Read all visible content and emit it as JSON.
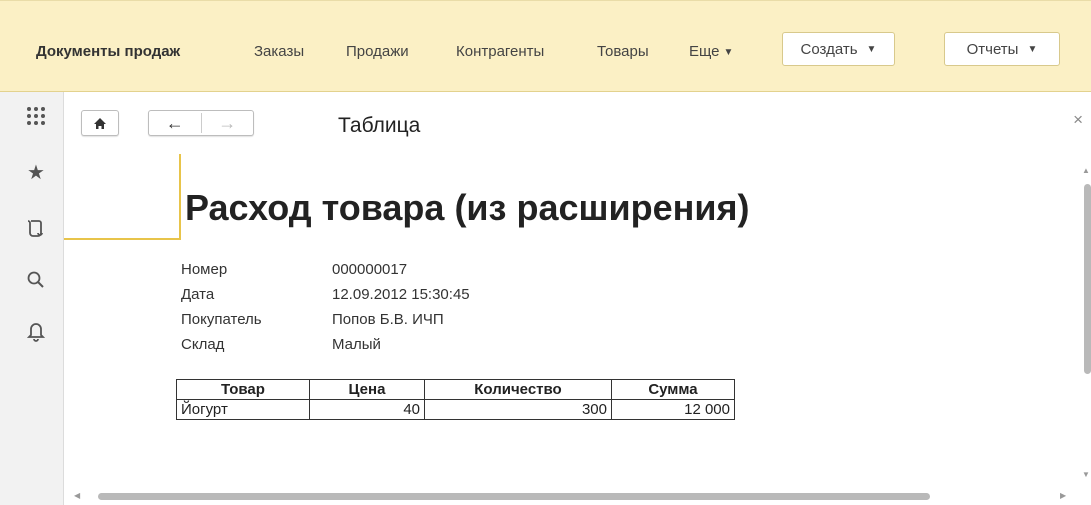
{
  "topnav": {
    "items": [
      {
        "label": "Документы продаж",
        "active": true
      },
      {
        "label": "Заказы"
      },
      {
        "label": "Продажи"
      },
      {
        "label": "Контрагенты"
      },
      {
        "label": "Товары"
      },
      {
        "label": "Еще"
      }
    ],
    "create_label": "Создать",
    "reports_label": "Отчеты"
  },
  "sidebar": {
    "icons": [
      "apps-grid-icon",
      "favorites-star-icon",
      "history-icon",
      "search-icon",
      "notifications-bell-icon"
    ]
  },
  "form": {
    "title": "Таблица",
    "close": "×"
  },
  "report": {
    "heading": "Расход товара (из расширения)",
    "fields": [
      {
        "label": "Номер",
        "value": "000000017"
      },
      {
        "label": "Дата",
        "value": "12.09.2012 15:30:45"
      },
      {
        "label": "Покупатель",
        "value": "Попов Б.В. ИЧП"
      },
      {
        "label": "Склад",
        "value": "Малый"
      }
    ],
    "table": {
      "headers": [
        "Товар",
        "Цена",
        "Количество",
        "Сумма"
      ],
      "rows": [
        [
          "Йогурт",
          "40",
          "300",
          "12 000"
        ]
      ]
    }
  },
  "colors": {
    "topbar_bg": "#fbf0c5",
    "accent_line": "#e8c44a",
    "sidebar_bg": "#f2f2f2"
  }
}
